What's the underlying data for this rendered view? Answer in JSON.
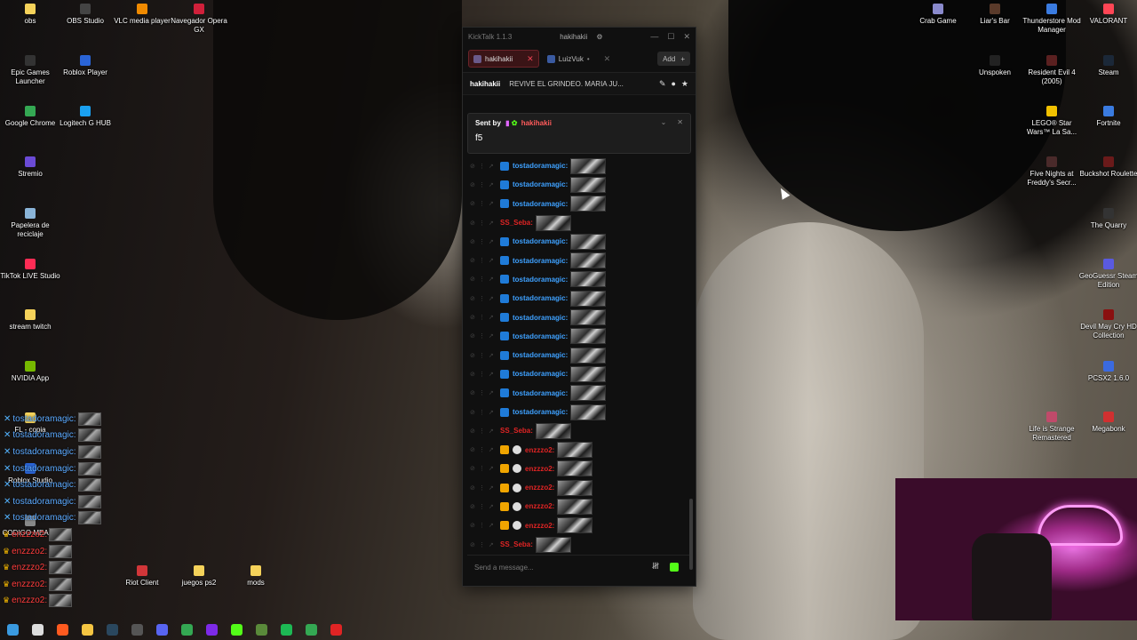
{
  "desktop": {
    "left_icons": [
      {
        "label": "obs",
        "color": "#f5d25a"
      },
      {
        "label": "OBS Studio",
        "color": "#444"
      },
      {
        "label": "VLC media player",
        "color": "#f08a00"
      },
      {
        "label": "Navegador Opera GX",
        "color": "#d0203a"
      },
      {
        "label": "Epic Games Launcher",
        "color": "#333"
      },
      {
        "label": "Roblox Player",
        "color": "#2a64d6"
      },
      {
        "label": "Google Chrome",
        "color": "#34a853"
      },
      {
        "label": "Logitech G HUB",
        "color": "#1aa0f0"
      },
      {
        "label": "Stremio",
        "color": "#6b4bd6"
      },
      {
        "label": "Papelera de reciclaje",
        "color": "#8ab4d8"
      },
      {
        "label": "TikTok LIVE Studio",
        "color": "#fe2c55"
      },
      {
        "label": "stream twitch",
        "color": "#f5d25a"
      },
      {
        "label": "NVIDIA App",
        "color": "#76b900"
      },
      {
        "label": "FL - copia",
        "color": "#f5d25a"
      },
      {
        "label": "Roblox Studio",
        "color": "#2a64d6"
      },
      {
        "label": "CODIGO MEASE",
        "color": "#888"
      },
      {
        "label": "Riot Client",
        "color": "#d13639"
      },
      {
        "label": "juegos ps2",
        "color": "#f5d25a"
      },
      {
        "label": "mods",
        "color": "#f5d25a"
      }
    ],
    "right_icons": [
      {
        "label": "Crab Game",
        "color": "#8a8acc"
      },
      {
        "label": "Liar's Bar",
        "color": "#5a3a2a"
      },
      {
        "label": "Thunderstore Mod Manager",
        "color": "#3a7be0"
      },
      {
        "label": "VALORANT",
        "color": "#ff4655"
      },
      {
        "label": "Unspoken",
        "color": "#222"
      },
      {
        "label": "Resident Evil 4 (2005)",
        "color": "#5a2020"
      },
      {
        "label": "Steam",
        "color": "#1b2838"
      },
      {
        "label": "LEGO® Star Wars™ La Sa...",
        "color": "#f0c000"
      },
      {
        "label": "Fortnite",
        "color": "#3a7be0"
      },
      {
        "label": "Five Nights at Freddy's Secr...",
        "color": "#4a2a2a"
      },
      {
        "label": "Buckshot Roulette",
        "color": "#6a1a1a"
      },
      {
        "label": "The Quarry",
        "color": "#333"
      },
      {
        "label": "GeoGuessr Steam Edition",
        "color": "#5a5ae0"
      },
      {
        "label": "Devil May Cry HD Collection",
        "color": "#8a1010"
      },
      {
        "label": "PCSX2 1.6.0",
        "color": "#3a6ae0"
      },
      {
        "label": "Life is Strange Remastered",
        "color": "#c04a6a"
      },
      {
        "label": "Megabonk",
        "color": "#d03030"
      }
    ]
  },
  "overlay_chat": [
    {
      "name": "tostadoramagic:",
      "color": "blue",
      "kind": "twitter"
    },
    {
      "name": "tostadoramagic:",
      "color": "blue",
      "kind": "twitter"
    },
    {
      "name": "tostadoramagic:",
      "color": "blue",
      "kind": "twitter"
    },
    {
      "name": "tostadoramagic:",
      "color": "blue",
      "kind": "twitter"
    },
    {
      "name": "tostadoramagic:",
      "color": "blue",
      "kind": "twitter"
    },
    {
      "name": "tostadoramagic:",
      "color": "blue",
      "kind": "twitter"
    },
    {
      "name": "tostadoramagic:",
      "color": "blue",
      "kind": "twitter"
    },
    {
      "name": "enzzzo2:",
      "color": "red",
      "kind": "crown"
    },
    {
      "name": "enzzzo2:",
      "color": "red",
      "kind": "crown"
    },
    {
      "name": "enzzzo2:",
      "color": "red",
      "kind": "crown"
    },
    {
      "name": "enzzzo2:",
      "color": "red",
      "kind": "crown"
    },
    {
      "name": "enzzzo2:",
      "color": "red",
      "kind": "crown"
    }
  ],
  "kicktalk": {
    "app_title": "KickTalk 1.1.3",
    "window_user": "hakihakii",
    "tabs": [
      {
        "label": "hakihakii",
        "active": true
      },
      {
        "label": "LuizVuk",
        "active": false
      }
    ],
    "add_label": "Add",
    "pinned_channel": "hakihakii",
    "stream_title": "REVIVE EL GRINDEO. MARIA JU...",
    "pinned": {
      "sent_by_label": "Sent by",
      "sender": "hakihakii",
      "message": "f5"
    },
    "messages": [
      {
        "user": "tostadoramagic:",
        "color": "blue",
        "badge": "verified"
      },
      {
        "user": "tostadoramagic:",
        "color": "blue",
        "badge": "verified"
      },
      {
        "user": "tostadoramagic:",
        "color": "blue",
        "badge": "verified"
      },
      {
        "user": "SS_Seba:",
        "color": "red",
        "badge": ""
      },
      {
        "user": "tostadoramagic:",
        "color": "blue",
        "badge": "verified"
      },
      {
        "user": "tostadoramagic:",
        "color": "blue",
        "badge": "verified"
      },
      {
        "user": "tostadoramagic:",
        "color": "blue",
        "badge": "verified"
      },
      {
        "user": "tostadoramagic:",
        "color": "blue",
        "badge": "verified"
      },
      {
        "user": "tostadoramagic:",
        "color": "blue",
        "badge": "verified"
      },
      {
        "user": "tostadoramagic:",
        "color": "blue",
        "badge": "verified"
      },
      {
        "user": "tostadoramagic:",
        "color": "blue",
        "badge": "verified"
      },
      {
        "user": "tostadoramagic:",
        "color": "blue",
        "badge": "verified"
      },
      {
        "user": "tostadoramagic:",
        "color": "blue",
        "badge": "verified"
      },
      {
        "user": "tostadoramagic:",
        "color": "blue",
        "badge": "verified"
      },
      {
        "user": "SS_Seba:",
        "color": "red",
        "badge": ""
      },
      {
        "user": "enzzzo2:",
        "color": "red",
        "badge": "crown"
      },
      {
        "user": "enzzzo2:",
        "color": "red",
        "badge": "crown"
      },
      {
        "user": "enzzzo2:",
        "color": "red",
        "badge": "crown"
      },
      {
        "user": "enzzzo2:",
        "color": "red",
        "badge": "crown"
      },
      {
        "user": "enzzzo2:",
        "color": "red",
        "badge": "crown"
      },
      {
        "user": "SS_Seba:",
        "color": "red",
        "badge": ""
      }
    ],
    "input_placeholder": "Send a message..."
  },
  "taskbar": [
    {
      "name": "start-icon",
      "color": "#3a9ae0"
    },
    {
      "name": "search-icon",
      "color": "#ddd"
    },
    {
      "name": "brave-icon",
      "color": "#ff5a1f"
    },
    {
      "name": "file-explorer-icon",
      "color": "#f5c542"
    },
    {
      "name": "steam-icon",
      "color": "#2a475e"
    },
    {
      "name": "obs-icon",
      "color": "#555"
    },
    {
      "name": "discord-icon",
      "color": "#5865f2"
    },
    {
      "name": "chrome-icon",
      "color": "#34a853"
    },
    {
      "name": "canva-icon",
      "color": "#7d2ae8"
    },
    {
      "name": "kick-icon",
      "color": "#53fc18"
    },
    {
      "name": "minecraft-icon",
      "color": "#5a8a3a"
    },
    {
      "name": "spotify-icon",
      "color": "#1db954"
    },
    {
      "name": "chrome-active-icon",
      "color": "#34a853"
    },
    {
      "name": "tiktok-live-icon",
      "color": "#e02424"
    }
  ]
}
